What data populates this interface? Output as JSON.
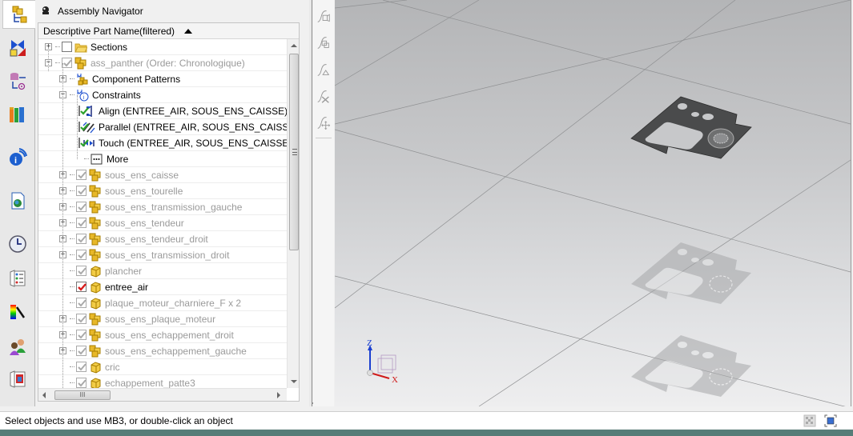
{
  "navigator": {
    "title": "Assembly Navigator",
    "column_header": "Descriptive Part Name(filtered)",
    "rows": [
      {
        "label": "Sections",
        "level": 0,
        "expander": "+",
        "checkbox": "empty",
        "icon": "folder-icon",
        "dim": false
      },
      {
        "label": "ass_panther (Order: Chronologique)",
        "level": 0,
        "expander": "-",
        "checkbox": "grey-checked",
        "icon": "assembly-icon",
        "dim": true
      },
      {
        "label": "Component Patterns",
        "level": 1,
        "expander": "+",
        "checkbox": "none",
        "icon": "component-patterns-icon",
        "dim": false
      },
      {
        "label": "Constraints",
        "level": 1,
        "expander": "-",
        "checkbox": "none",
        "icon": "constraints-icon",
        "dim": false
      },
      {
        "label": "Align (ENTREE_AIR, SOUS_ENS_CAISSE)",
        "level": 2,
        "expander": "",
        "checkbox": "green-checked",
        "icon": "align-icon",
        "dim": false
      },
      {
        "label": "Parallel (ENTREE_AIR, SOUS_ENS_CAISSE)",
        "level": 2,
        "expander": "",
        "checkbox": "green-checked",
        "icon": "parallel-icon",
        "dim": false
      },
      {
        "label": "Touch (ENTREE_AIR, SOUS_ENS_CAISSE)",
        "level": 2,
        "expander": "",
        "checkbox": "green-checked",
        "icon": "touch-icon",
        "dim": false
      },
      {
        "label": "More",
        "level": 2,
        "expander": "",
        "checkbox": "none",
        "icon": "more-icon",
        "dim": false
      },
      {
        "label": "sous_ens_caisse",
        "level": 1,
        "expander": "+",
        "checkbox": "grey-checked",
        "icon": "assembly-icon",
        "dim": true
      },
      {
        "label": "sous_ens_tourelle",
        "level": 1,
        "expander": "+",
        "checkbox": "grey-checked",
        "icon": "assembly-icon",
        "dim": true
      },
      {
        "label": "sous_ens_transmission_gauche",
        "level": 1,
        "expander": "+",
        "checkbox": "grey-checked",
        "icon": "assembly-icon",
        "dim": true
      },
      {
        "label": "sous_ens_tendeur",
        "level": 1,
        "expander": "+",
        "checkbox": "grey-checked",
        "icon": "assembly-icon",
        "dim": true
      },
      {
        "label": "sous_ens_tendeur_droit",
        "level": 1,
        "expander": "+",
        "checkbox": "grey-checked",
        "icon": "assembly-icon",
        "dim": true
      },
      {
        "label": "sous_ens_transmission_droit",
        "level": 1,
        "expander": "+",
        "checkbox": "grey-checked",
        "icon": "assembly-icon",
        "dim": true
      },
      {
        "label": "plancher",
        "level": 1,
        "expander": "",
        "checkbox": "grey-checked",
        "icon": "part-icon",
        "dim": true
      },
      {
        "label": "entree_air",
        "level": 1,
        "expander": "",
        "checkbox": "red-checked",
        "icon": "part-icon",
        "dim": false
      },
      {
        "label": "plaque_moteur_charniere_F x 2",
        "level": 1,
        "expander": "",
        "checkbox": "grey-checked",
        "icon": "part-icon",
        "dim": true
      },
      {
        "label": "sous_ens_plaque_moteur",
        "level": 1,
        "expander": "+",
        "checkbox": "grey-checked",
        "icon": "assembly-icon",
        "dim": true
      },
      {
        "label": "sous_ens_echappement_droit",
        "level": 1,
        "expander": "+",
        "checkbox": "grey-checked",
        "icon": "assembly-icon",
        "dim": true
      },
      {
        "label": "sous_ens_echappement_gauche",
        "level": 1,
        "expander": "+",
        "checkbox": "grey-checked",
        "icon": "assembly-icon",
        "dim": true
      },
      {
        "label": "cric",
        "level": 1,
        "expander": "",
        "checkbox": "grey-checked",
        "icon": "part-icon",
        "dim": true
      },
      {
        "label": "echappement_patte3",
        "level": 1,
        "expander": "",
        "checkbox": "grey-checked",
        "icon": "part-icon",
        "dim": true
      }
    ]
  },
  "resource_bar": {
    "tabs": [
      {
        "name": "assembly-navigator-tab",
        "active": true
      },
      {
        "name": "constraint-navigator-tab",
        "active": false
      },
      {
        "name": "part-navigator-tab",
        "active": false
      },
      {
        "name": "reuse-library-tab",
        "active": false
      },
      {
        "name": "hd3d-tools-tab",
        "active": false
      },
      {
        "name": "web-browser-tab",
        "active": false
      },
      {
        "name": "history-tab",
        "active": false
      },
      {
        "name": "process-studio-tab",
        "active": false
      },
      {
        "name": "visualization-tab",
        "active": false
      },
      {
        "name": "roles-tab",
        "active": false
      },
      {
        "name": "system-scene-tab",
        "active": false
      }
    ]
  },
  "side_toolbar": {
    "buttons": [
      "sketch-add-icon",
      "sketch-copy-icon",
      "sketch-triangle-icon",
      "sketch-delete-icon",
      "sketch-move-icon"
    ]
  },
  "viewport": {
    "triad_labels": {
      "z": "Z",
      "x": "X"
    }
  },
  "statusbar": {
    "message": "Select objects and use MB3, or double-click an object"
  },
  "scrollbar": {
    "h_thumb_label": "III"
  },
  "colors": {
    "check_green": "#2ca02c",
    "check_red": "#d81b1b",
    "dim_text": "#9a9a9a",
    "assembly_yellow": "#e8b828"
  }
}
